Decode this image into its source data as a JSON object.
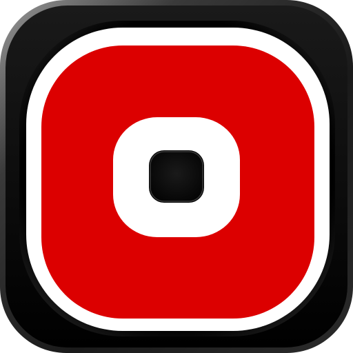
{
  "icon": {
    "name": "record-button-app-icon",
    "shape": "rounded-square",
    "colors": {
      "tile_black": "#0b0b0b",
      "tile_highlight": "#8a8a8a",
      "ring_dark": "#050505",
      "white_border": "#ffffff",
      "red": "#dc0000",
      "center_hole": "#000000"
    }
  }
}
